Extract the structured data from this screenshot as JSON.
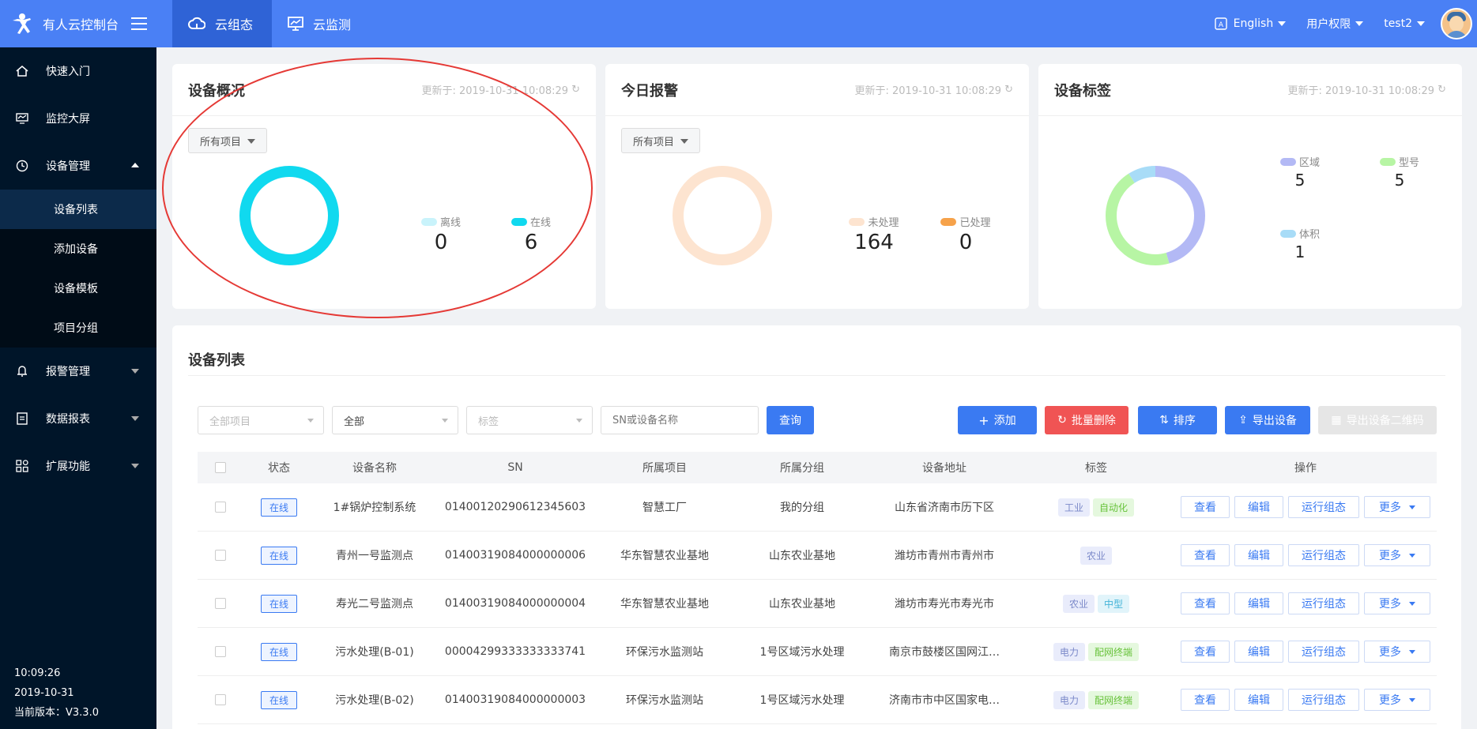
{
  "brand": {
    "name": "有人云控制台",
    "logo_icon": "person-logo-icon",
    "menu_icon": "hamburger-icon"
  },
  "top_tabs": [
    {
      "label": "云组态",
      "icon": "cloud-icon",
      "active": true
    },
    {
      "label": "云监测",
      "icon": "monitor-icon",
      "active": false
    }
  ],
  "top_right": {
    "language": "English",
    "language_icon": "translate-icon",
    "permission": "用户权限",
    "user": "test2"
  },
  "sidebar": {
    "items": [
      {
        "label": "快速入门",
        "icon": "home-icon"
      },
      {
        "label": "监控大屏",
        "icon": "screen-icon"
      },
      {
        "label": "设备管理",
        "icon": "clock-icon",
        "expanded": true
      },
      {
        "label": "报警管理",
        "icon": "bell-icon"
      },
      {
        "label": "数据报表",
        "icon": "report-icon"
      },
      {
        "label": "扩展功能",
        "icon": "grid-icon"
      }
    ],
    "sub_items": [
      {
        "label": "设备列表",
        "active": true
      },
      {
        "label": "添加设备",
        "active": false
      },
      {
        "label": "设备模板",
        "active": false
      },
      {
        "label": "项目分组",
        "active": false
      }
    ],
    "footer": {
      "time": "10:09:26",
      "date": "2019-10-31",
      "version": "当前版本：V3.3.0"
    }
  },
  "cards": {
    "overview": {
      "title": "设备概况",
      "updated": "更新于: 2019-10-31 10:08:29",
      "filter": "所有项目",
      "legend": [
        {
          "label": "离线",
          "value": "0",
          "color": "#c9f3fb"
        },
        {
          "label": "在线",
          "value": "6",
          "color": "#10d9ef"
        }
      ]
    },
    "alarm": {
      "title": "今日报警",
      "updated": "更新于: 2019-10-31 10:08:29",
      "filter": "所有项目",
      "legend": [
        {
          "label": "未处理",
          "value": "164",
          "color": "#fde4d0"
        },
        {
          "label": "已处理",
          "value": "0",
          "color": "#f6a24a"
        }
      ]
    },
    "tags": {
      "title": "设备标签",
      "updated": "更新于: 2019-10-31 10:08:29",
      "legend": [
        {
          "label": "区域",
          "value": "5",
          "color": "#b3b9f5"
        },
        {
          "label": "型号",
          "value": "5",
          "color": "#b7f5a4"
        },
        {
          "label": "体积",
          "value": "1",
          "color": "#a8dcf7"
        }
      ]
    }
  },
  "device_list": {
    "title": "设备列表",
    "filters": {
      "project": "全部项目",
      "all": "全部",
      "tag": "标签",
      "search_placeholder": "SN或设备名称",
      "query": "查询"
    },
    "actions": {
      "add": "添加",
      "batch_delete": "批量删除",
      "sort": "排序",
      "export": "导出设备",
      "export_qr": "导出设备二维码"
    },
    "columns": [
      "状态",
      "设备名称",
      "SN",
      "所属项目",
      "所属分组",
      "设备地址",
      "标签",
      "操作"
    ],
    "ops": {
      "view": "查看",
      "edit": "编辑",
      "run": "运行组态",
      "more": "更多"
    },
    "rows": [
      {
        "status": "在线",
        "name": "1#锅炉控制系统",
        "sn": "01400120290612345603",
        "project": "智慧工厂",
        "group": "我的分组",
        "address": "山东省济南市历下区",
        "tags": [
          {
            "t": "工业",
            "c": "purple"
          },
          {
            "t": "自动化",
            "c": "green"
          }
        ]
      },
      {
        "status": "在线",
        "name": "青州一号监测点",
        "sn": "01400319084000000006",
        "project": "华东智慧农业基地",
        "group": "山东农业基地",
        "address": "潍坊市青州市青州市",
        "tags": [
          {
            "t": "农业",
            "c": "purple"
          }
        ]
      },
      {
        "status": "在线",
        "name": "寿光二号监测点",
        "sn": "01400319084000000004",
        "project": "华东智慧农业基地",
        "group": "山东农业基地",
        "address": "潍坊市寿光市寿光市",
        "tags": [
          {
            "t": "农业",
            "c": "purple"
          },
          {
            "t": "中型",
            "c": "cyan"
          }
        ]
      },
      {
        "status": "在线",
        "name": "污水处理(B-01)",
        "sn": "00004299333333333741",
        "project": "环保污水监测站",
        "group": "1号区域污水处理",
        "address": "南京市鼓楼区国网江…",
        "tags": [
          {
            "t": "电力",
            "c": "purple"
          },
          {
            "t": "配网终端",
            "c": "green"
          }
        ]
      },
      {
        "status": "在线",
        "name": "污水处理(B-02)",
        "sn": "01400319084000000003",
        "project": "环保污水监测站",
        "group": "1号区域污水处理",
        "address": "济南市市中区国家电…",
        "tags": [
          {
            "t": "电力",
            "c": "purple"
          },
          {
            "t": "配网终端",
            "c": "green"
          }
        ]
      }
    ]
  }
}
